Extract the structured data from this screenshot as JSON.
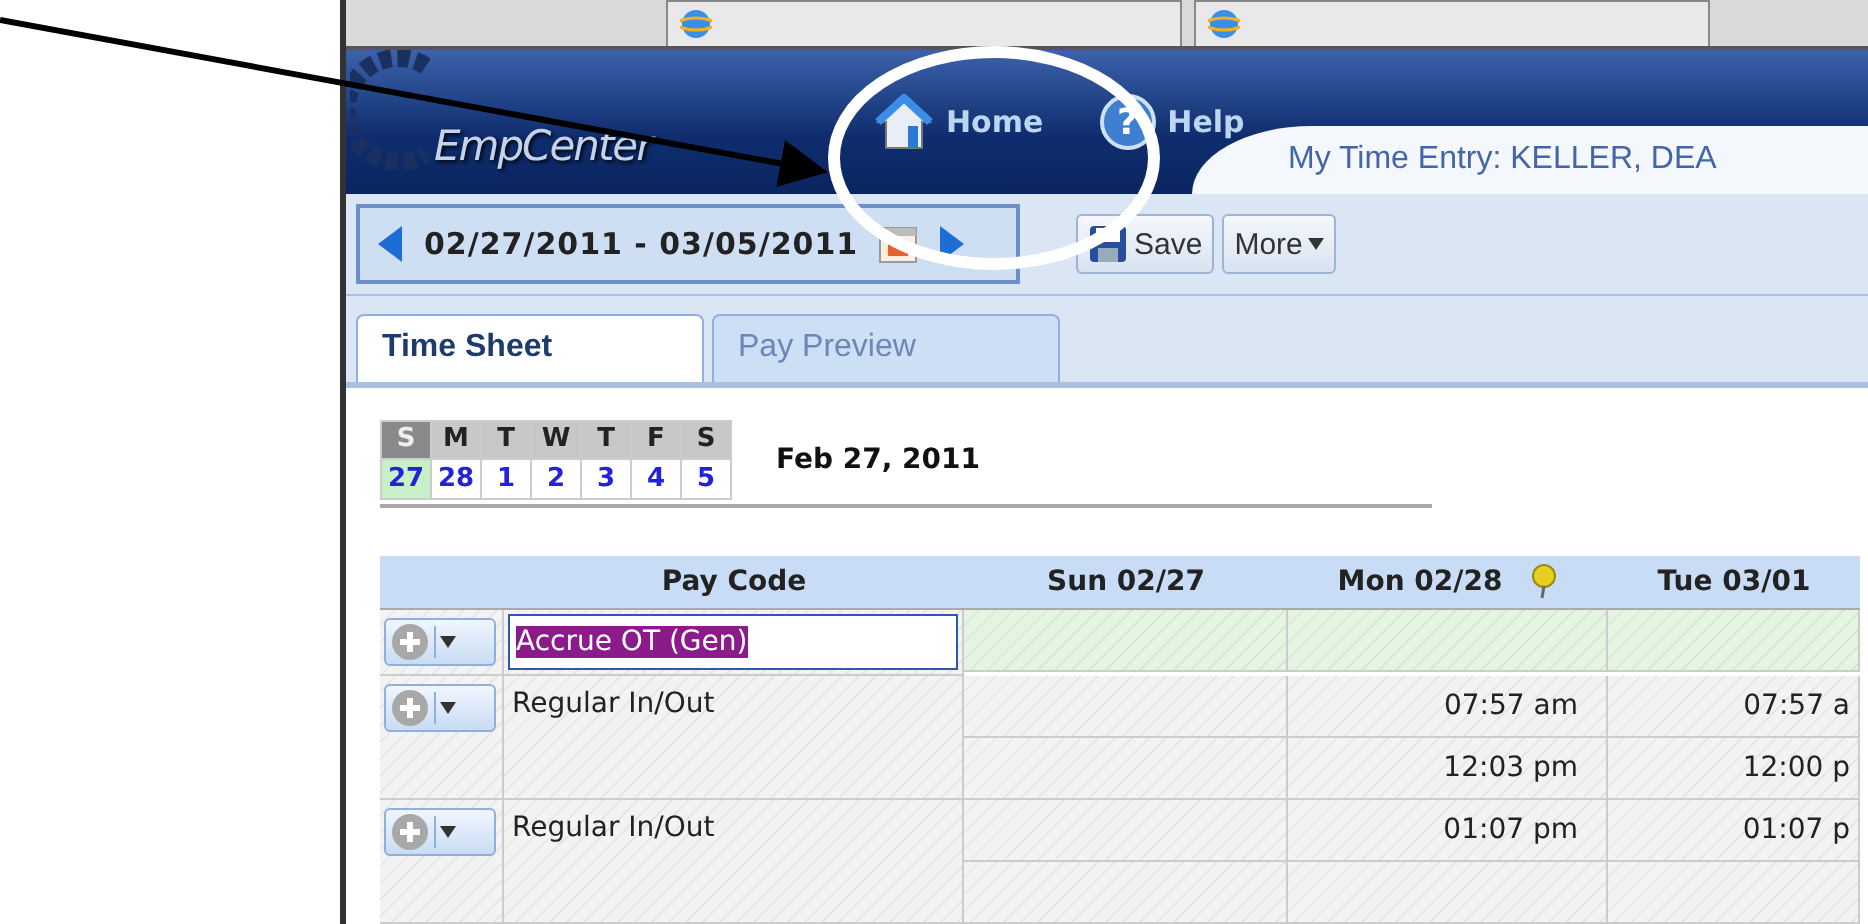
{
  "header": {
    "logo": "EmpCenter",
    "nav": [
      {
        "label": "Home"
      },
      {
        "label": "Help",
        "glyph": "?"
      }
    ],
    "page_title": "My Time Entry: KELLER, DEA"
  },
  "toolbar": {
    "date_range": "02/27/2011 - 03/05/2011",
    "buttons": [
      {
        "label": "Save",
        "kind": "save"
      },
      {
        "label": "More",
        "kind": "menu"
      }
    ]
  },
  "tabs": [
    {
      "label": "Time Sheet",
      "selected": true
    },
    {
      "label": "Pay Preview",
      "selected": false
    }
  ],
  "week": {
    "days": [
      {
        "letter": "S",
        "date": "27",
        "selected": true
      },
      {
        "letter": "M",
        "date": "28",
        "selected": false
      },
      {
        "letter": "T",
        "date": "1",
        "selected": false
      },
      {
        "letter": "W",
        "date": "2",
        "selected": false
      },
      {
        "letter": "T",
        "date": "3",
        "selected": false
      },
      {
        "letter": "F",
        "date": "4",
        "selected": false
      },
      {
        "letter": "S",
        "date": "5",
        "selected": false
      }
    ],
    "selected_date": "Feb 27, 2011"
  },
  "grid": {
    "columns": [
      {
        "label": "Pay Code",
        "pinned": false
      },
      {
        "label": "Sun 02/27",
        "pinned": false
      },
      {
        "label": "Mon 02/28",
        "pinned": true
      },
      {
        "label": "Tue 03/01",
        "pinned": false
      }
    ],
    "rows": [
      {
        "pay_code": "Accrue OT (Gen)",
        "editing": true,
        "lines": [
          {
            "cells": [
              null,
              null,
              null
            ]
          }
        ]
      },
      {
        "pay_code": "Regular In/Out",
        "editing": false,
        "lines": [
          {
            "cells": [
              null,
              "07:57 am",
              "07:57 a"
            ]
          },
          {
            "cells": [
              null,
              "12:03 pm",
              "12:00 p"
            ]
          }
        ]
      },
      {
        "pay_code": "Regular In/Out",
        "editing": false,
        "lines": [
          {
            "cells": [
              null,
              "01:07 pm",
              "01:07 p"
            ]
          },
          {
            "cells": [
              null,
              null,
              null
            ]
          }
        ]
      }
    ]
  }
}
